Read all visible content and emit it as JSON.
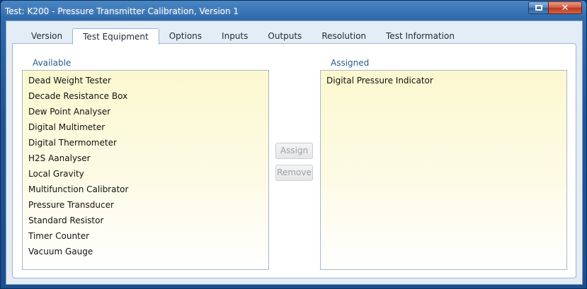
{
  "window": {
    "title": "Test: K200 - Pressure Transmitter Calibration, Version 1",
    "controls": {
      "restore_icon": "restore-icon",
      "close_icon": "close-icon"
    }
  },
  "tabs": [
    {
      "label": "Version",
      "active": false
    },
    {
      "label": "Test Equipment",
      "active": true
    },
    {
      "label": "Options",
      "active": false
    },
    {
      "label": "Inputs",
      "active": false
    },
    {
      "label": "Outputs",
      "active": false
    },
    {
      "label": "Resolution",
      "active": false
    },
    {
      "label": "Test Information",
      "active": false
    }
  ],
  "available": {
    "label": "Available",
    "items": [
      "Dead Weight Tester",
      "Decade Resistance Box",
      "Dew Point Analyser",
      "Digital Multimeter",
      "Digital Thermometer",
      "H2S Aanalyser",
      "Local Gravity",
      "Multifunction Calibrator",
      "Pressure Transducer",
      "Standard Resistor",
      "Timer Counter",
      "Vacuum Gauge"
    ]
  },
  "assigned": {
    "label": "Assigned",
    "items": [
      "Digital Pressure Indicator"
    ]
  },
  "buttons": {
    "assign": "Assign",
    "remove": "Remove"
  },
  "colors": {
    "title_bar": "#1f5597",
    "list_background": "#fbf8cf",
    "label_text": "#2a5a8f",
    "disabled_text": "#9aa0a8"
  }
}
